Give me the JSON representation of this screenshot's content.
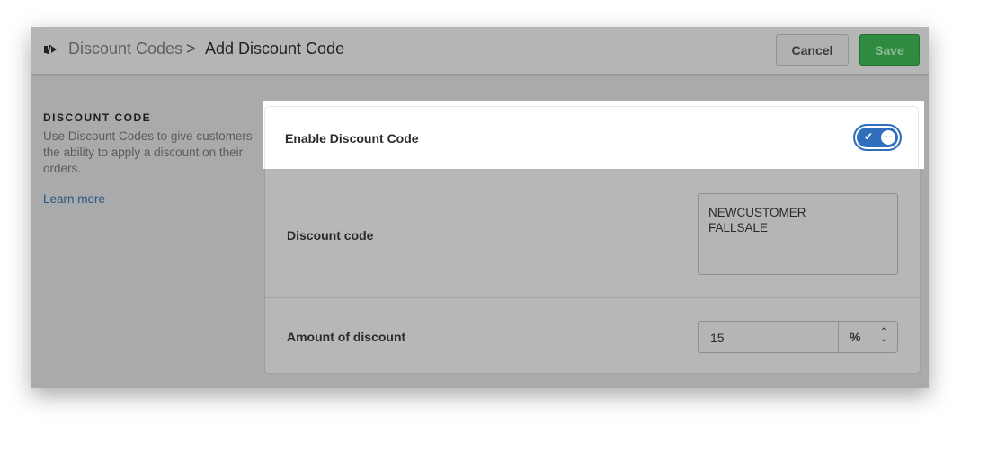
{
  "header": {
    "breadcrumb_parent": "Discount Codes",
    "separator": ">",
    "title": "Add Discount Code",
    "cancel_label": "Cancel",
    "save_label": "Save",
    "save_color": "#2e8b3f"
  },
  "sidebar": {
    "heading": "DISCOUNT CODE",
    "description": "Use Discount Codes to give customers the ability to apply a discount on their orders.",
    "learn_more": "Learn more"
  },
  "form": {
    "enable": {
      "label": "Enable Discount Code",
      "enabled": true,
      "toggle_color": "#2f6fbe"
    },
    "code": {
      "label": "Discount code",
      "value": "NEWCUSTOMER\nFALLSALE"
    },
    "amount": {
      "label": "Amount of discount",
      "value": "15",
      "unit": "%"
    }
  }
}
